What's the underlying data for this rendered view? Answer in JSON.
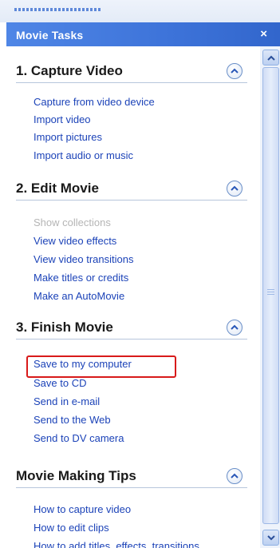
{
  "panel": {
    "title": "Movie Tasks",
    "close_icon": "close-icon"
  },
  "sections": [
    {
      "title": "1. Capture Video",
      "tasks": [
        {
          "label": "Capture from video device",
          "enabled": true
        },
        {
          "label": "Import video",
          "enabled": true
        },
        {
          "label": "Import pictures",
          "enabled": true
        },
        {
          "label": "Import audio or music",
          "enabled": true
        }
      ]
    },
    {
      "title": "2. Edit Movie",
      "tasks": [
        {
          "label": "Show collections",
          "enabled": false
        },
        {
          "label": "View video effects",
          "enabled": true
        },
        {
          "label": "View video transitions",
          "enabled": true
        },
        {
          "label": "Make titles or credits",
          "enabled": true
        },
        {
          "label": "Make an AutoMovie",
          "enabled": true
        }
      ]
    },
    {
      "title": "3. Finish Movie",
      "tasks": [
        {
          "label": "Save to my computer",
          "enabled": true,
          "highlighted": true
        },
        {
          "label": "Save to CD",
          "enabled": true
        },
        {
          "label": "Send in e-mail",
          "enabled": true
        },
        {
          "label": "Send to the Web",
          "enabled": true
        },
        {
          "label": "Send to DV camera",
          "enabled": true
        }
      ]
    },
    {
      "title": "Movie Making Tips",
      "tasks": [
        {
          "label": "How to capture video",
          "enabled": true
        },
        {
          "label": "How to edit clips",
          "enabled": true
        },
        {
          "label": "How to add titles, effects, transitions",
          "enabled": true
        }
      ]
    }
  ],
  "colors": {
    "header": "#3d73d9",
    "link": "#1c43b8",
    "disabled": "#b5b5b5",
    "highlight": "#d81a1a"
  }
}
